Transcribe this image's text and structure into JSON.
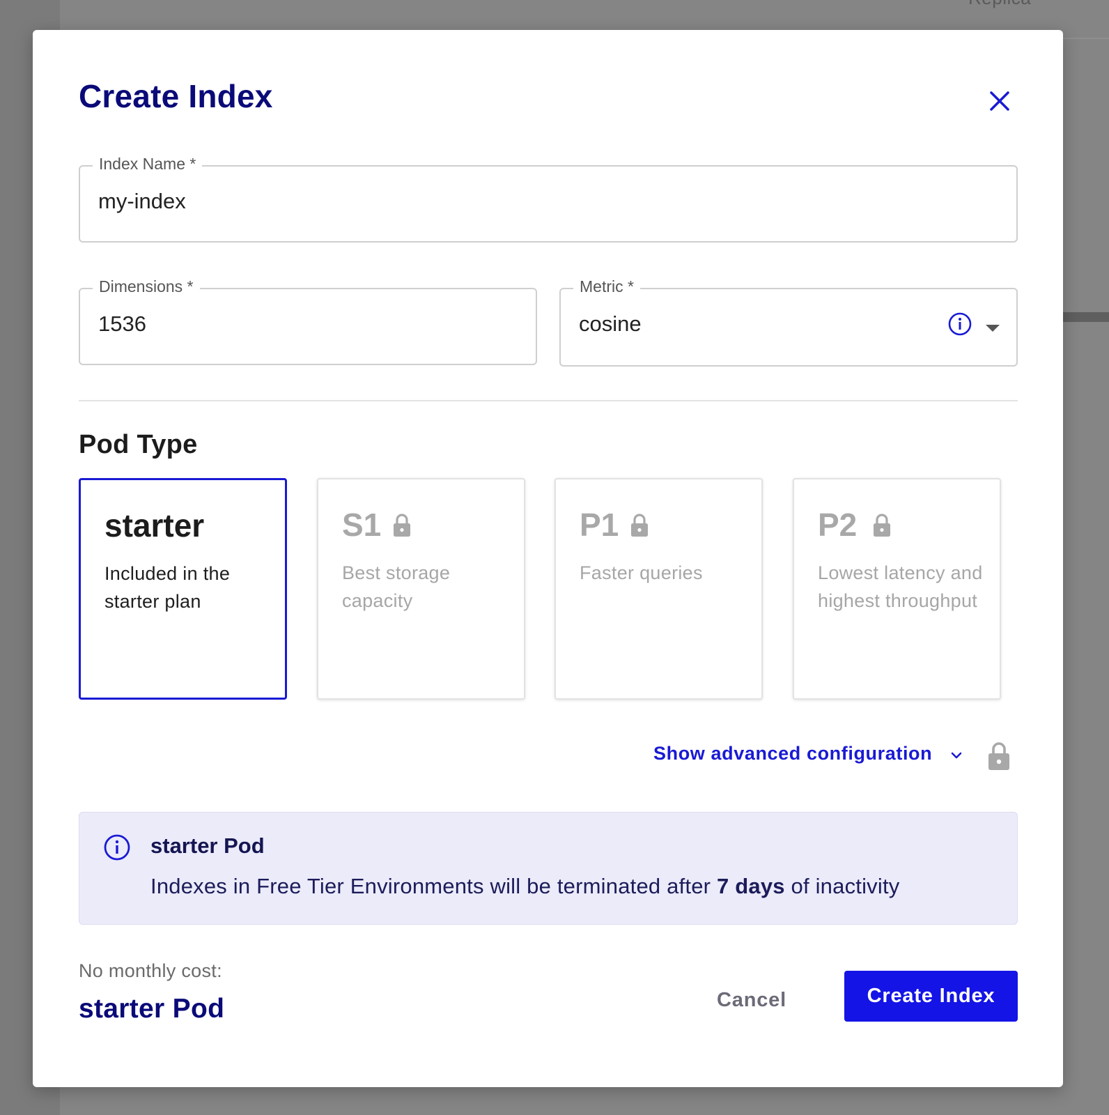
{
  "background": {
    "header_text": "Replica"
  },
  "dialog": {
    "title": "Create Index",
    "close_icon": "close-icon"
  },
  "fields": {
    "index_name": {
      "label": "Index Name *",
      "value": "my-index"
    },
    "dimensions": {
      "label": "Dimensions *",
      "value": "1536"
    },
    "metric": {
      "label": "Metric *",
      "value": "cosine",
      "info_icon": "info-icon",
      "dropdown_icon": "caret-down-icon"
    }
  },
  "pod_type": {
    "title": "Pod Type",
    "options": [
      {
        "name": "starter",
        "description": "Included in the starter plan",
        "selected": true,
        "locked": false
      },
      {
        "name": "S1",
        "description": "Best storage capacity",
        "selected": false,
        "locked": true
      },
      {
        "name": "P1",
        "description": "Faster queries",
        "selected": false,
        "locked": true
      },
      {
        "name": "P2",
        "description": "Lowest latency and highest throughput",
        "selected": false,
        "locked": true
      }
    ]
  },
  "advanced": {
    "label": "Show advanced configuration",
    "chevron_icon": "chevron-down-icon",
    "lock_icon": "lock-icon"
  },
  "notice": {
    "title": "starter Pod",
    "text_before": "Indexes in Free Tier Environments will be terminated after ",
    "text_bold": "7 days",
    "text_after": " of inactivity"
  },
  "cost": {
    "label": "No monthly cost:",
    "value": "starter Pod"
  },
  "actions": {
    "cancel": "Cancel",
    "create": "Create Index"
  },
  "colors": {
    "accent": "#1414e6",
    "title": "#0a0a78",
    "notice_bg": "#ebebfa",
    "locked_text": "#a8a8a8"
  }
}
